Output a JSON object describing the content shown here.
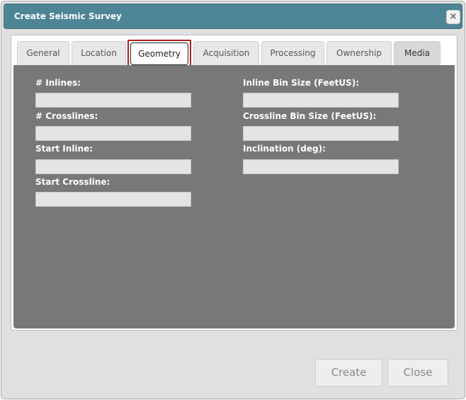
{
  "dialog": {
    "title": "Create Seismic Survey",
    "close_icon": "×"
  },
  "tabs": [
    {
      "label": "General"
    },
    {
      "label": "Location"
    },
    {
      "label": "Geometry",
      "active": true
    },
    {
      "label": "Acquisition"
    },
    {
      "label": "Processing"
    },
    {
      "label": "Ownership"
    },
    {
      "label": "Media"
    }
  ],
  "geometry": {
    "left_fields": [
      {
        "label": "# Inlines:",
        "value": ""
      },
      {
        "label": "# Crosslines:",
        "value": ""
      },
      {
        "label": "Start Inline:",
        "value": ""
      },
      {
        "label": "Start Crossline:",
        "value": ""
      }
    ],
    "right_fields": [
      {
        "label": "Inline Bin Size (FeetUS):",
        "value": ""
      },
      {
        "label": "Crossline Bin Size (FeetUS):",
        "value": ""
      },
      {
        "label": "Inclination (deg):",
        "value": ""
      }
    ]
  },
  "buttons": {
    "create_label": "Create",
    "close_label": "Close"
  }
}
